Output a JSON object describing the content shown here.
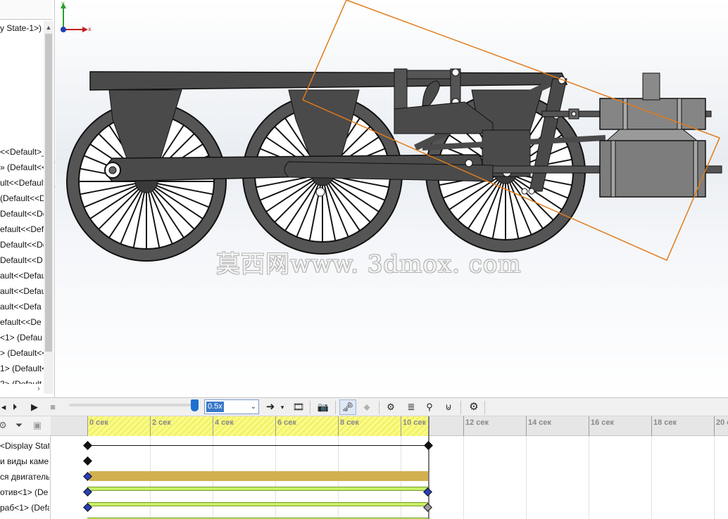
{
  "feature_tree": {
    "header_row": "y State-1>)",
    "items": [
      "<<Default>_",
      "» (Default<<",
      "ult<<Default",
      "(Default<<D",
      "Default<<De",
      "efault<<Def",
      "Default<<De",
      "Default<<D",
      "ault<<Defau",
      "ault<<Defau",
      "ault<<Defa",
      "efault<<De",
      "<1> (Defau",
      "> (Default<<",
      "1> (Default<",
      "2> (Default"
    ]
  },
  "viewport": {
    "watermark": "莫西网www. 3dmox. com",
    "triad": {
      "x_label": "x",
      "y_label": "y"
    }
  },
  "toolbar": {
    "play_speed": "0.5x",
    "icons": [
      "step-back-icon",
      "play-from-start-icon",
      "play-icon",
      "stop-icon",
      "playback-mode-icon",
      "save-animation-icon",
      "animation-wizard-icon",
      "autokey-icon",
      "add-key-icon",
      "motor-icon",
      "spring-icon",
      "contact-icon",
      "gravity-icon",
      "study-properties-icon"
    ]
  },
  "timeline": {
    "labels": [
      "<Display Stat",
      "и виды камер",
      "ся двигатель",
      "отив<1> (De",
      "раб<1> (Defa"
    ],
    "ticks": [
      "0 сек",
      "2 сек",
      "4 сек",
      "6 сек",
      "8 сек",
      "10 сек",
      "12 сек",
      "14 сек",
      "16 сек",
      "18 сек",
      "20 с"
    ],
    "end_time_sec": 10.8,
    "colors": {
      "highlight": "#f2f26a",
      "motor_bar": "#d2b04f",
      "component_bar": "#c9f06a",
      "key_blue": "#2a3fb8",
      "key_gray": "#9a9a9a"
    }
  }
}
